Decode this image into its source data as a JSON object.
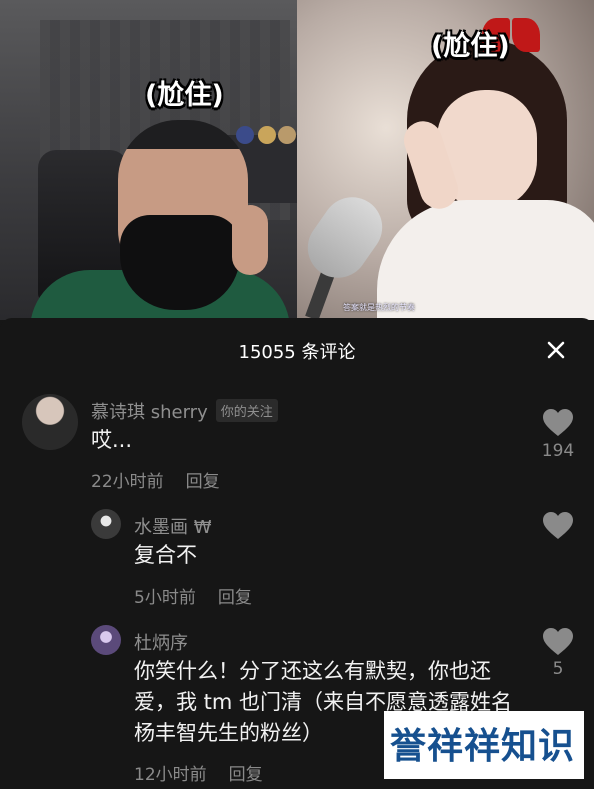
{
  "video": {
    "left_caption": "(尬住)",
    "right_caption": "(尬住)",
    "subtitle": "答案就是热烈的节奏"
  },
  "comments_panel": {
    "title": "15055 条评论",
    "close_icon": "close-icon"
  },
  "comments": [
    {
      "author": "慕诗琪 sherry",
      "tag": "你的关注",
      "text": "哎...",
      "time": "22小时前",
      "reply_label": "回复",
      "likes": "194"
    },
    {
      "author": "水墨画 ₩",
      "text": "复合不",
      "time": "5小时前",
      "reply_label": "回复",
      "likes": ""
    },
    {
      "author": "杜炳序",
      "text": "你笑什么！分了还这么有默契，你也还爱，我 tm 也门清（来自不愿意透露姓名杨丰智先生的粉丝）",
      "time": "12小时前",
      "reply_label": "回复",
      "likes": "5"
    }
  ],
  "watermark": {
    "text": "誉祥祥知识"
  },
  "colors": {
    "panel_bg": "#161616",
    "muted_text": "#8a8a8a",
    "watermark_blue": "#16508f",
    "bow_red": "#c01818"
  }
}
